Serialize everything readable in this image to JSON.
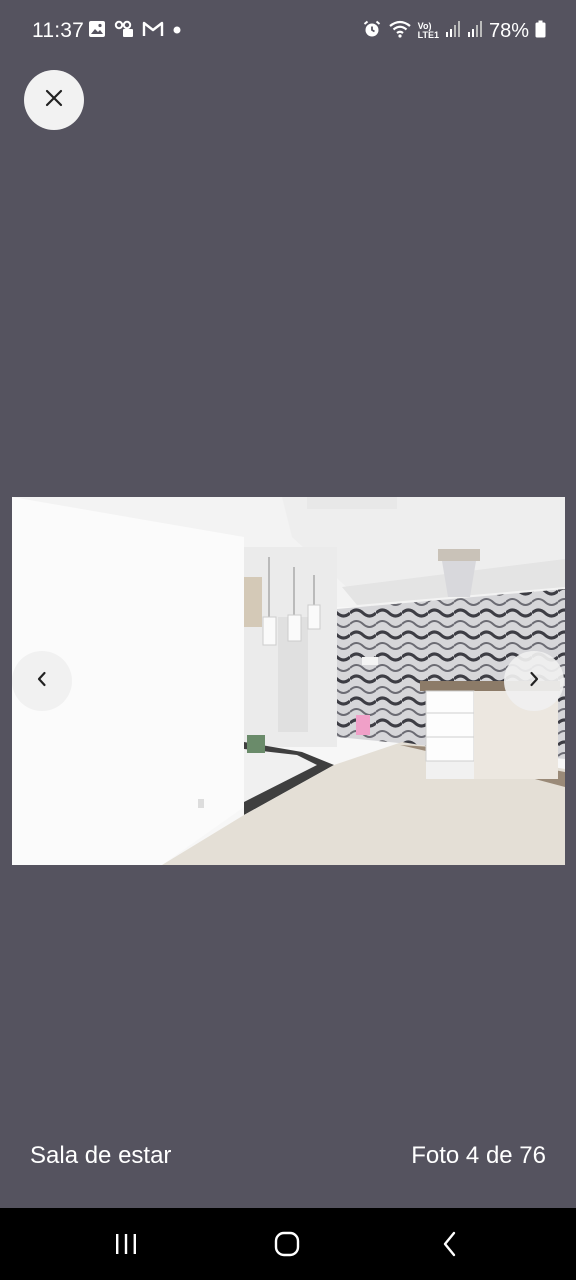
{
  "status_bar": {
    "time": "11:37",
    "battery": "78%",
    "lte_line1": "Vo)",
    "lte_line2": "LTE1",
    "left_icons": [
      "gallery-icon",
      "voicemail-icon",
      "gmail-icon",
      "dot-icon"
    ],
    "right_icons": [
      "alarm-icon",
      "wifi-icon",
      "signal-icon",
      "signal-icon",
      "battery-icon"
    ]
  },
  "viewer": {
    "close_icon": "close-icon",
    "prev_icon": "chevron-left-icon",
    "next_icon": "chevron-right-icon",
    "room_label": "Sala de estar",
    "photo_counter": "Foto 4 de 76",
    "photo_alt": "Sala de estar"
  },
  "android_nav": {
    "recents_icon": "recents-icon",
    "home_icon": "home-icon",
    "back_icon": "back-icon"
  },
  "colors": {
    "background": "#55535f",
    "button_bg": "#f2f2f2",
    "text": "#ffffff",
    "nav_bar": "#000000"
  }
}
